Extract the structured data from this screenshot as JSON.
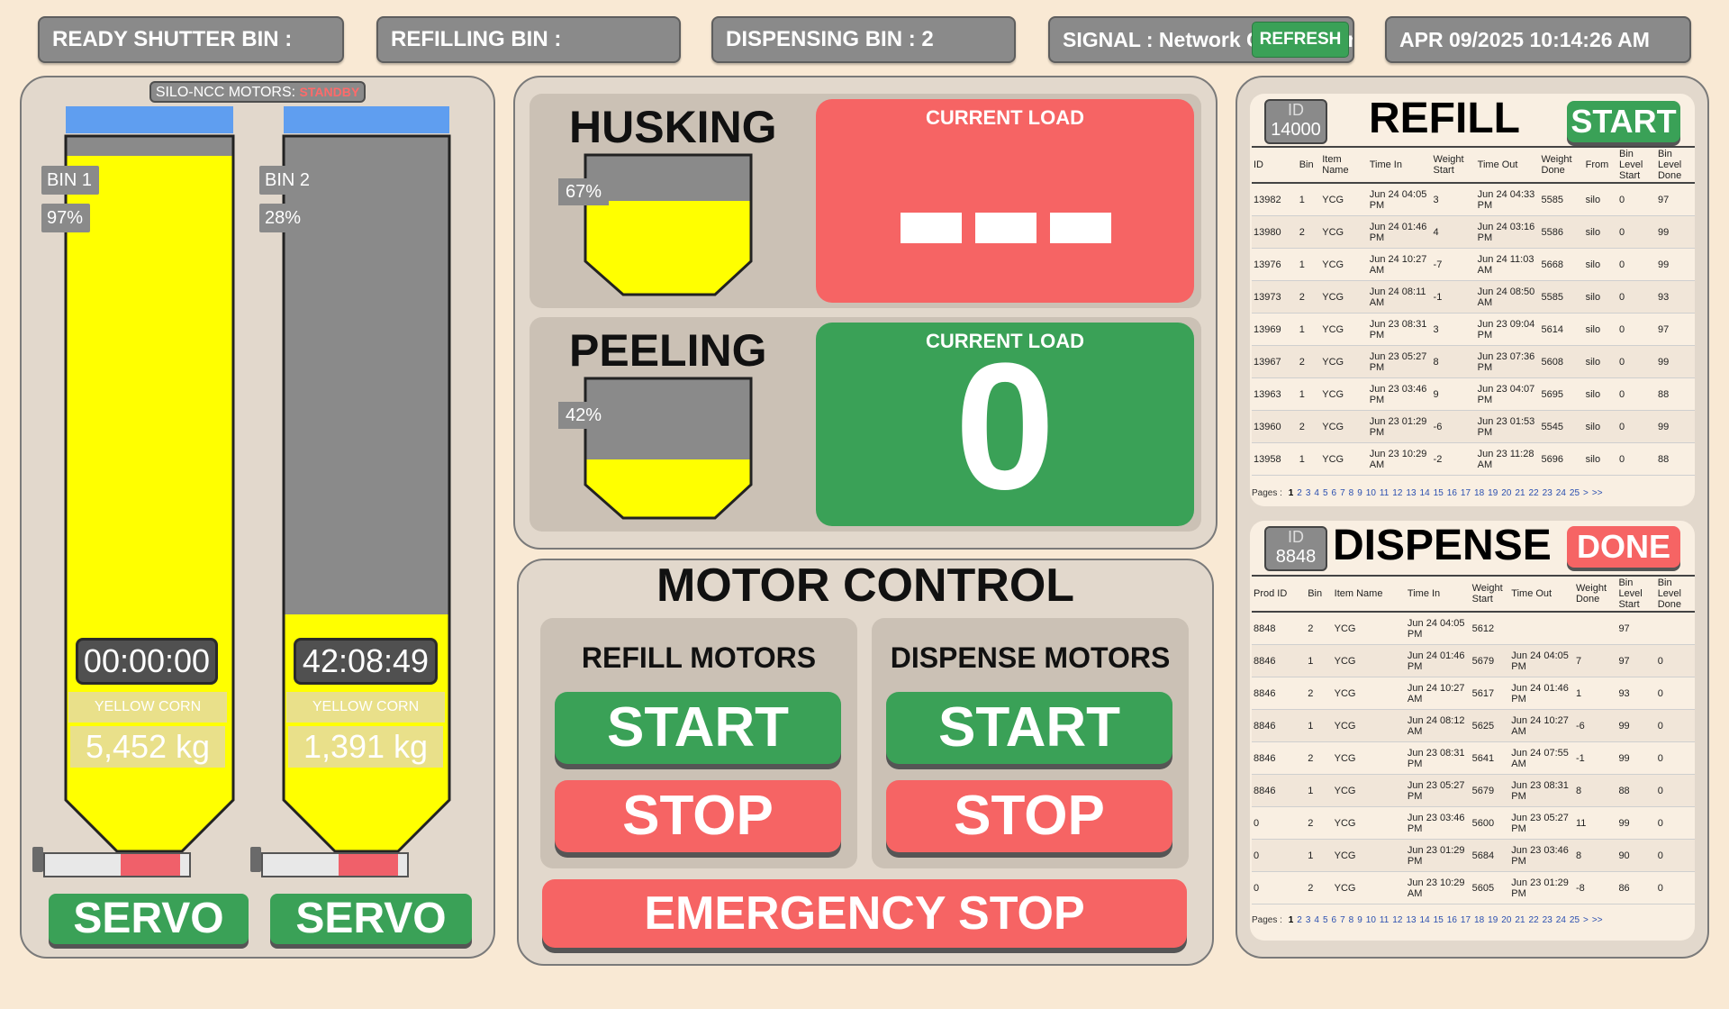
{
  "status_bar": {
    "ready_shutter": "READY SHUTTER BIN :",
    "refilling": "REFILLING BIN :",
    "dispensing": "DISPENSING BIN :  2",
    "signal": "SIGNAL : Network Connection API not supported",
    "refresh": "REFRESH",
    "datetime": "APR 09/2025 10:14:26 AM"
  },
  "silo": {
    "motor_label": "SILO-NCC MOTORS:",
    "motor_state": "STANDBY",
    "bins": [
      {
        "name": "BIN 1",
        "percent": "97%",
        "level": 0.97,
        "timer": "00:00:00",
        "grain": "YELLOW CORN GRAINS",
        "weight": "5,452 kg",
        "servo": "SERVO",
        "servo_position": 0.48
      },
      {
        "name": "BIN 2",
        "percent": "28%",
        "level": 0.28,
        "timer": "42:08:49",
        "grain": "YELLOW CORN GRAINS",
        "weight": "1,391 kg",
        "servo": "SERVO",
        "servo_position": 0.48
      }
    ]
  },
  "process": {
    "husking": {
      "title": "HUSKING",
      "percent": "67%",
      "level": 0.67,
      "load_title": "CURRENT LOAD",
      "color": "#f66464"
    },
    "peeling": {
      "title": "PEELING",
      "percent": "42%",
      "level": 0.42,
      "load_title": "CURRENT LOAD",
      "load_value": "0",
      "color": "#3aa157"
    }
  },
  "motor_control": {
    "title": "MOTOR CONTROL",
    "refill_title": "REFILL MOTORS",
    "dispense_title": "DISPENSE MOTORS",
    "start": "START",
    "stop": "STOP",
    "emergency": "EMERGENCY STOP"
  },
  "refill": {
    "id_label": "ID",
    "id_value": "14000",
    "title": "REFILL",
    "button": "START",
    "headers": [
      "ID",
      "Bin",
      "Item Name",
      "Time In",
      "Weight Start",
      "Time Out",
      "Weight Done",
      "From",
      "Bin Level Start",
      "Bin Level Done"
    ],
    "rows": [
      [
        "13982",
        "1",
        "YCG",
        "Jun 24 04:05 PM",
        "3",
        "Jun 24 04:33 PM",
        "5585",
        "silo",
        "0",
        "97"
      ],
      [
        "13980",
        "2",
        "YCG",
        "Jun 24 01:46 PM",
        "4",
        "Jun 24 03:16 PM",
        "5586",
        "silo",
        "0",
        "99"
      ],
      [
        "13976",
        "1",
        "YCG",
        "Jun 24 10:27 AM",
        "-7",
        "Jun 24 11:03 AM",
        "5668",
        "silo",
        "0",
        "99"
      ],
      [
        "13973",
        "2",
        "YCG",
        "Jun 24 08:11 AM",
        "-1",
        "Jun 24 08:50 AM",
        "5585",
        "silo",
        "0",
        "93"
      ],
      [
        "13969",
        "1",
        "YCG",
        "Jun 23 08:31 PM",
        "3",
        "Jun 23 09:04 PM",
        "5614",
        "silo",
        "0",
        "97"
      ],
      [
        "13967",
        "2",
        "YCG",
        "Jun 23 05:27 PM",
        "8",
        "Jun 23 07:36 PM",
        "5608",
        "silo",
        "0",
        "99"
      ],
      [
        "13963",
        "1",
        "YCG",
        "Jun 23 03:46 PM",
        "9",
        "Jun 23 04:07 PM",
        "5695",
        "silo",
        "0",
        "88"
      ],
      [
        "13960",
        "2",
        "YCG",
        "Jun 23 01:29 PM",
        "-6",
        "Jun 23 01:53 PM",
        "5545",
        "silo",
        "0",
        "99"
      ],
      [
        "13958",
        "1",
        "YCG",
        "Jun 23 10:29 AM",
        "-2",
        "Jun 23 11:28 AM",
        "5696",
        "silo",
        "0",
        "88"
      ]
    ],
    "pages_label": "Pages :",
    "pages": [
      "1",
      "2",
      "3",
      "4",
      "5",
      "6",
      "7",
      "8",
      "9",
      "10",
      "11",
      "12",
      "13",
      "14",
      "15",
      "16",
      "17",
      "18",
      "19",
      "20",
      "21",
      "22",
      "23",
      "24",
      "25",
      ">",
      ">>"
    ]
  },
  "dispense": {
    "id_label": "ID",
    "id_value": "8848",
    "title": "DISPENSE",
    "button": "DONE",
    "headers": [
      "Prod ID",
      "Bin",
      "Item Name",
      "Time In",
      "Weight Start",
      "Time Out",
      "Weight Done",
      "Bin Level Start",
      "Bin Level Done"
    ],
    "rows": [
      [
        "8848",
        "2",
        "YCG",
        "Jun 24 04:05 PM",
        "5612",
        "",
        "",
        "97",
        ""
      ],
      [
        "8846",
        "1",
        "YCG",
        "Jun 24 01:46 PM",
        "5679",
        "Jun 24 04:05 PM",
        "7",
        "97",
        "0"
      ],
      [
        "8846",
        "2",
        "YCG",
        "Jun 24 10:27 AM",
        "5617",
        "Jun 24 01:46 PM",
        "1",
        "93",
        "0"
      ],
      [
        "8846",
        "1",
        "YCG",
        "Jun 24 08:12 AM",
        "5625",
        "Jun 24 10:27 AM",
        "-6",
        "99",
        "0"
      ],
      [
        "8846",
        "2",
        "YCG",
        "Jun 23 08:31 PM",
        "5641",
        "Jun 24 07:55 AM",
        "-1",
        "99",
        "0"
      ],
      [
        "8846",
        "1",
        "YCG",
        "Jun 23 05:27 PM",
        "5679",
        "Jun 23 08:31 PM",
        "8",
        "88",
        "0"
      ],
      [
        "0",
        "2",
        "YCG",
        "Jun 23 03:46 PM",
        "5600",
        "Jun 23 05:27 PM",
        "11",
        "99",
        "0"
      ],
      [
        "0",
        "1",
        "YCG",
        "Jun 23 01:29 PM",
        "5684",
        "Jun 23 03:46 PM",
        "8",
        "90",
        "0"
      ],
      [
        "0",
        "2",
        "YCG",
        "Jun 23 10:29 AM",
        "5605",
        "Jun 23 01:29 PM",
        "-8",
        "86",
        "0"
      ]
    ],
    "pages_label": "Pages :",
    "pages": [
      "1",
      "2",
      "3",
      "4",
      "5",
      "6",
      "7",
      "8",
      "9",
      "10",
      "11",
      "12",
      "13",
      "14",
      "15",
      "16",
      "17",
      "18",
      "19",
      "20",
      "21",
      "22",
      "23",
      "24",
      "25",
      ">",
      ">>"
    ]
  }
}
